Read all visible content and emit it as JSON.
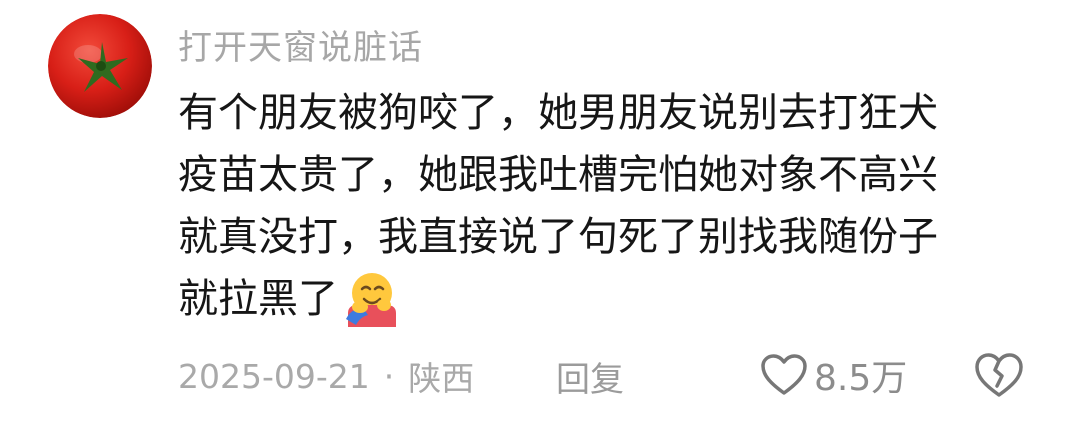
{
  "comment": {
    "username": "打开天窗说脏话",
    "text_lines": [
      "有个朋友被狗咬了，她男朋友说别去打狂犬",
      "疫苗太贵了，她跟我吐槽完怕她对象不高兴",
      "就真没打，我直接说了句死了别找我随份子",
      "就拉黑了"
    ],
    "emoji": "hugging-face",
    "date": "2025-09-21",
    "separator": "·",
    "location": "陕西",
    "reply_label": "回复",
    "like_count": "8.5万"
  },
  "icons": {
    "avatar": "tomato-avatar",
    "like": "heart-outline-icon",
    "dislike": "broken-heart-icon"
  },
  "colors": {
    "text": "#161616",
    "muted": "#a9a9a9",
    "tomato": "#d81f17"
  }
}
